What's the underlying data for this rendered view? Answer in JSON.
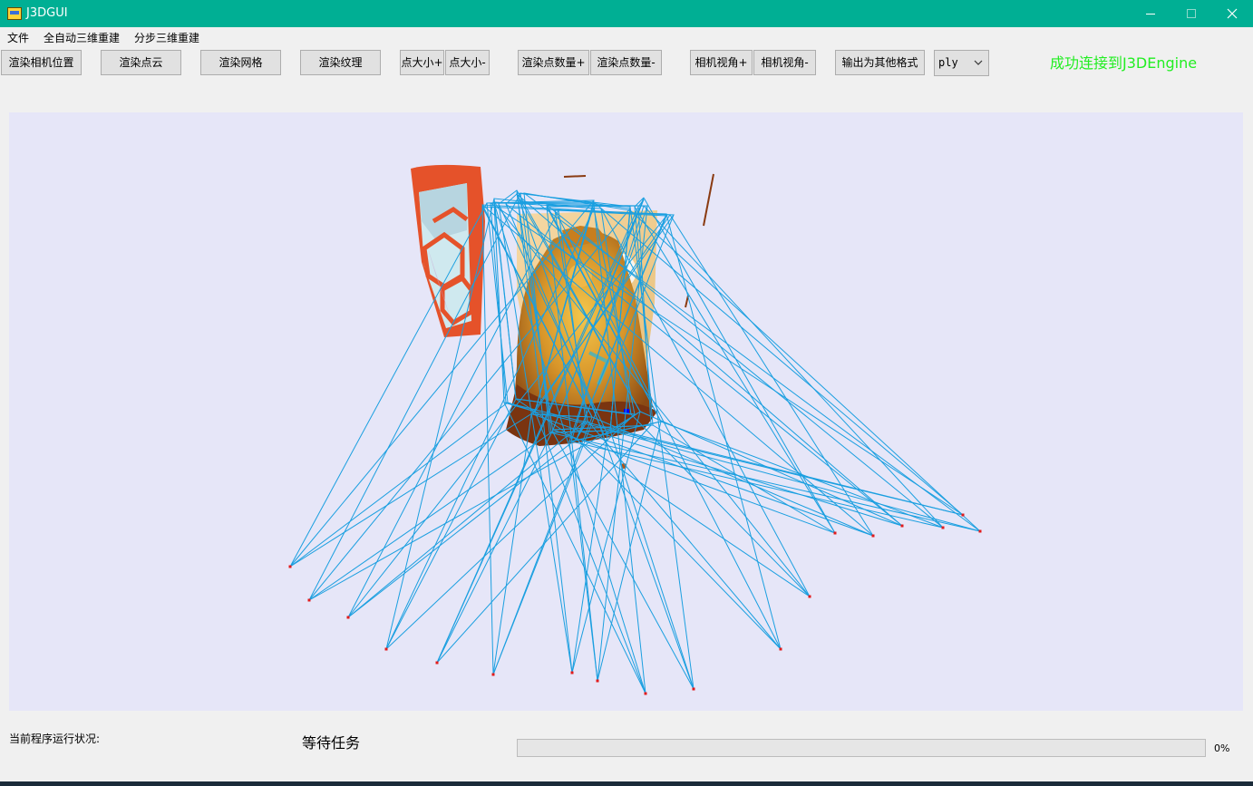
{
  "window": {
    "title": "J3DGUI"
  },
  "menu": {
    "items": [
      "文件",
      "全自动三维重建",
      "分步三维重建"
    ]
  },
  "toolbar": {
    "render_camera": "渲染相机位置",
    "render_pointcloud": "渲染点云",
    "render_mesh": "渲染网格",
    "render_texture": "渲染纹理",
    "point_size_plus": "点大小+",
    "point_size_minus": "点大小-",
    "point_count_plus": "渲染点数量+",
    "point_count_minus": "渲染点数量-",
    "fov_plus": "相机视角+",
    "fov_minus": "相机视角-",
    "export": "输出为其他格式",
    "format_value": "ply"
  },
  "connection_status": "成功连接到J3DEngine",
  "status": {
    "label": "当前程序运行状况:",
    "value": "等待任务",
    "progress_percent": 0,
    "progress_text": "0%"
  },
  "colors": {
    "titlebar": "#00af94",
    "connected": "#22ee22",
    "camera_frustum": "#1a9fe0",
    "camera_center": "#e21b1b",
    "viewport_bg": "#e6e6f8"
  },
  "icons": {
    "app": "app-icon",
    "minimize": "minimize-icon",
    "maximize": "maximize-icon",
    "close": "close-icon",
    "dropdown": "chevron-down-icon"
  }
}
